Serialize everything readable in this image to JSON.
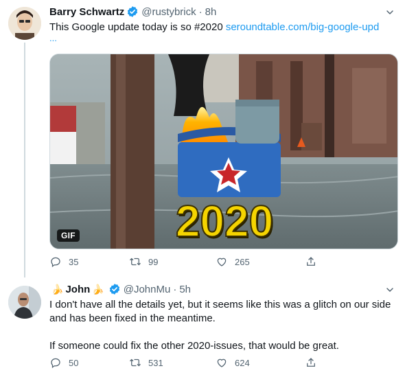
{
  "tweets": [
    {
      "display_name": "Barry Schwartz",
      "handle": "@rustybrick",
      "separator": "·",
      "time": "8h",
      "text": "This Google update today is so #2020 ",
      "link": "seroundtable.com/big-google-upd",
      "link_ellipsis": "...",
      "media_badge": "GIF",
      "media_caption": "2020",
      "reply_count": "35",
      "retweet_count": "99",
      "like_count": "265"
    },
    {
      "display_name": "John",
      "name_emoji": "🍌",
      "handle": "@JohnMu",
      "separator": "·",
      "time": "5h",
      "paragraphs": [
        "I don't have all the details yet, but it seems like this was a glitch on our side and has been fixed in the meantime.",
        "If someone could fix the other 2020-issues, that would be great."
      ],
      "reply_count": "50",
      "retweet_count": "531",
      "like_count": "624"
    }
  ],
  "colors": {
    "verified": "#1d9bf0",
    "link": "#1d9bf0",
    "muted": "#536471",
    "text": "#0f1419",
    "caption_yellow": "#f5d400"
  },
  "icons": [
    "verified-icon",
    "caret-down-icon",
    "reply-icon",
    "retweet-icon",
    "like-icon",
    "share-icon"
  ]
}
